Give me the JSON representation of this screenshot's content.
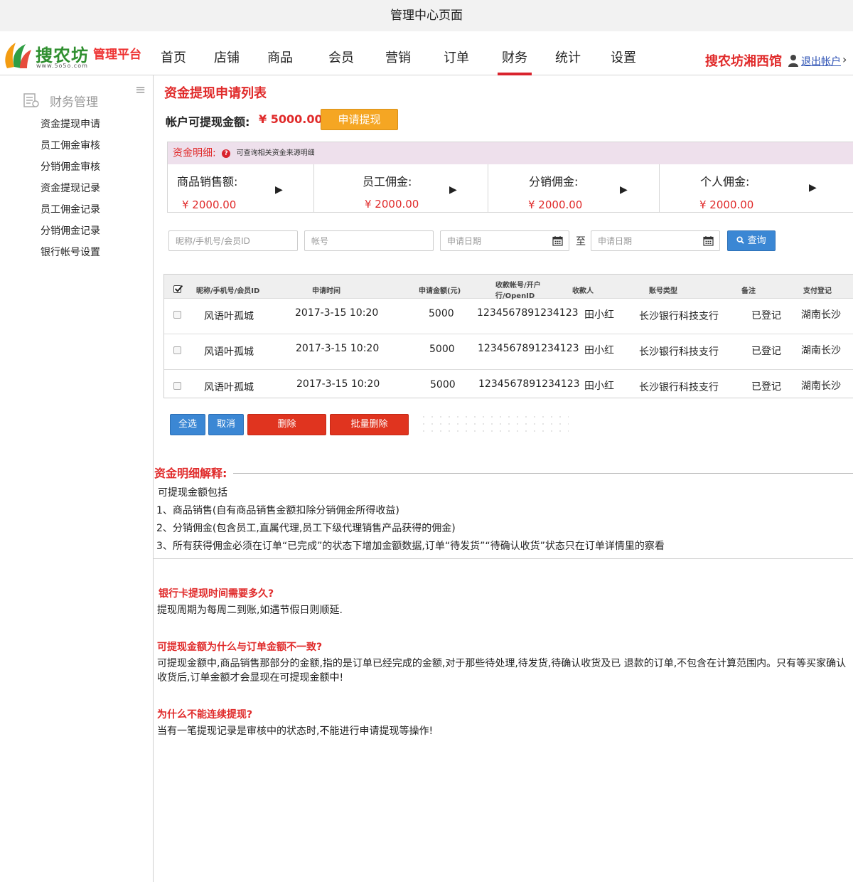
{
  "window": {
    "title": "管理中心页面"
  },
  "logo": {
    "name": "搜农坊",
    "url": "www.5o5o.com",
    "platform": "管理平台"
  },
  "nav": [
    {
      "label": "首页"
    },
    {
      "label": "店铺"
    },
    {
      "label": "商品"
    },
    {
      "label": "会员"
    },
    {
      "label": "营销"
    },
    {
      "label": "订单"
    },
    {
      "label": "财务",
      "active": true
    },
    {
      "label": "统计"
    },
    {
      "label": "设置"
    }
  ],
  "header": {
    "shop_name": "搜农坊湘西馆",
    "logout": "退出帐户",
    "logout_chevron": "›"
  },
  "sidebar": {
    "toggle": "≡",
    "title": "财务管理",
    "items": [
      {
        "label": "资金提现申请"
      },
      {
        "label": "员工佣金审核"
      },
      {
        "label": "分销佣金审核"
      },
      {
        "label": "资金提现记录"
      },
      {
        "label": "员工佣金记录"
      },
      {
        "label": "分销佣金记录"
      },
      {
        "label": "银行帐号设置"
      }
    ]
  },
  "main": {
    "title": "资金提现申请列表",
    "balance_label": "帐户可提现金额:",
    "balance_value": "¥ 5000.00",
    "apply_button": "申请提现",
    "detail": {
      "label": "资金明细:",
      "help_icon": "?",
      "note": "可查询相关资金来源明细",
      "cards": [
        {
          "label": "商品销售额:",
          "value": "¥  2000.00"
        },
        {
          "label": "员工佣金:",
          "value": "¥ 2000.00"
        },
        {
          "label": "分销佣金:",
          "value": "¥ 2000.00"
        },
        {
          "label": "个人佣金:",
          "value": "¥  2000.00"
        }
      ],
      "arrow": "▶"
    },
    "search": {
      "user_placeholder": "昵称/手机号/会员ID",
      "account_placeholder": "帐号",
      "date_start_placeholder": "申请日期",
      "date_sep": "至",
      "date_end_placeholder": "申请日期",
      "query_button": "查询"
    },
    "table": {
      "headers": {
        "user": "昵称/手机号/会员ID",
        "time": "申请时间",
        "amount": "申请金额(元)",
        "account_1": "收款帐号/开户",
        "account_2": "行/OpenID",
        "payee": "收款人",
        "type": "账号类型",
        "remark": "备注",
        "payment": "支付登记"
      },
      "rows": [
        {
          "user": "风语叶孤城",
          "time": "2017-3-15 10:20",
          "amount": "5000",
          "account": "1234567891234123",
          "payee": "田小红",
          "type": "长沙银行科技支行",
          "remark": "已登记",
          "payment": "湖南长沙"
        },
        {
          "user": "风语叶孤城",
          "time": "2017-3-15 10:20",
          "amount": "5000",
          "account": "1234567891234123",
          "payee": "田小红",
          "type": "长沙银行科技支行",
          "remark": "已登记",
          "payment": "湖南长沙"
        },
        {
          "user": "风语叶孤城",
          "time": "2017-3-15 10:20",
          "amount": "5000",
          "account": "1234567891234123",
          "payee": "田小红",
          "type": "长沙银行科技支行",
          "remark": "已登记",
          "payment": "湖南长沙"
        }
      ]
    },
    "buttons": {
      "select_all": "全选",
      "cancel": "取消",
      "delete": "删除",
      "batch_delete": "批量删除"
    },
    "explain": {
      "title": "资金明细解释:",
      "lines": [
        " 可提现金额包括",
        "1、商品销售(自有商品销售金额扣除分销佣金所得收益)",
        "2、分销佣金(包含员工,直属代理,员工下级代理销售产品获得的佣金)",
        "3、所有获得佣金必须在订单“已完成”的状态下增加金额数据,订单“待发货”“待确认收货”状态只在订单详情里的察看"
      ]
    },
    "faq": [
      {
        "q": " 银行卡提现时间需要多久?",
        "a": "提现周期为每周二到账,如遇节假日则顺延."
      },
      {
        "q": "可提现金额为什么与订单金额不一致?",
        "a": "可提现金额中,商品销售那部分的金额,指的是订单已经完成的金额,对于那些待处理,待发货,待确认收货及已 退款的订单,不包含在计算范围内。只有等买家确认收货后,订单金额才会显现在可提现金额中!"
      },
      {
        "q": "为什么不能连续提现?",
        "a": "当有一笔提现记录是审核中的状态时,不能进行申请提现等操作!"
      }
    ]
  },
  "colors": {
    "accent_red": "#e02a2a",
    "nav_active": "#d9232d",
    "button_orange": "#f5a623",
    "button_blue": "#3b87d4",
    "button_red": "#e0341f",
    "detail_header_bg": "#eee0ec"
  }
}
